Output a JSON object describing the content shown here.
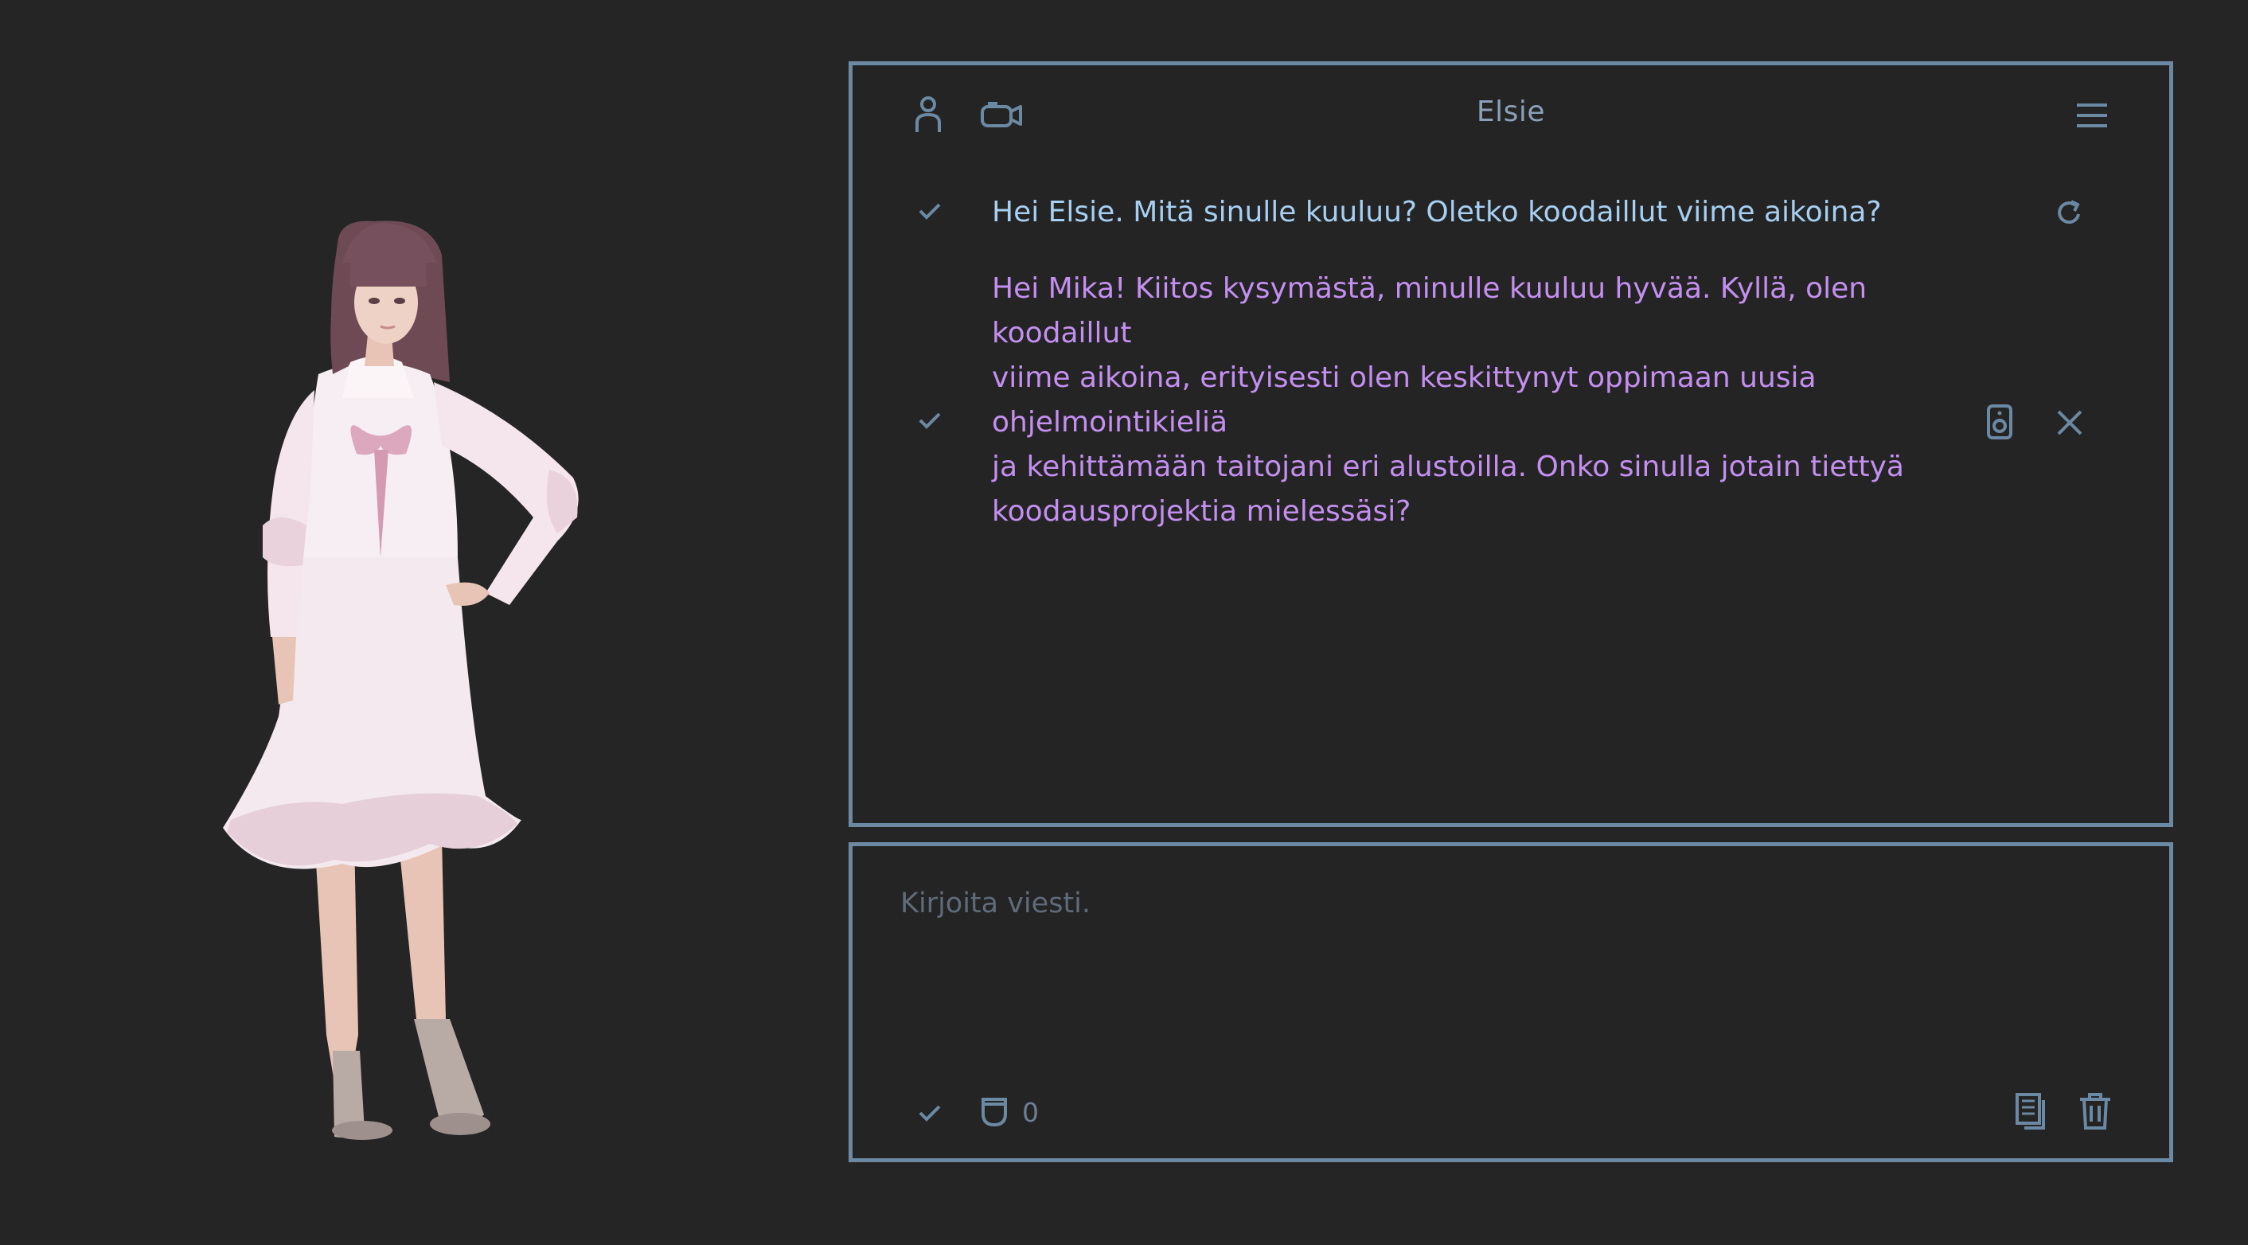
{
  "app": {
    "accent_color": "#6c89a4",
    "user_text_color": "#a6cff2",
    "assistant_text_color": "#c48ff0"
  },
  "avatar": {
    "description_icon": "character-avatar"
  },
  "chat": {
    "title": "Elsie",
    "header_icons": [
      "person-icon",
      "camera-icon",
      "menu-icon"
    ],
    "messages": [
      {
        "role": "user",
        "text": "Hei Elsie. Mitä sinulle kuuluu? Oletko koodaillut viime aikoina?",
        "status_icon": "check-icon",
        "action_icons": [
          "refresh-icon"
        ]
      },
      {
        "role": "assistant",
        "lines": [
          "Hei Mika! Kiitos kysymästä, minulle kuuluu hyvää. Kyllä, olen koodaillut",
          "viime aikoina, erityisesti olen keskittynyt oppimaan uusia ohjelmointikieliä",
          "ja kehittämään taitojani eri alustoilla. Onko sinulla jotain tiettyä",
          "koodausprojektia mielessäsi?"
        ],
        "status_icon": "check-icon",
        "action_icons": [
          "speaker-icon",
          "close-icon"
        ]
      }
    ]
  },
  "input": {
    "placeholder": "Kirjoita viesti.",
    "token_count": "0",
    "icons": [
      "check-icon",
      "cup-icon",
      "copy-icon",
      "trash-icon"
    ]
  }
}
